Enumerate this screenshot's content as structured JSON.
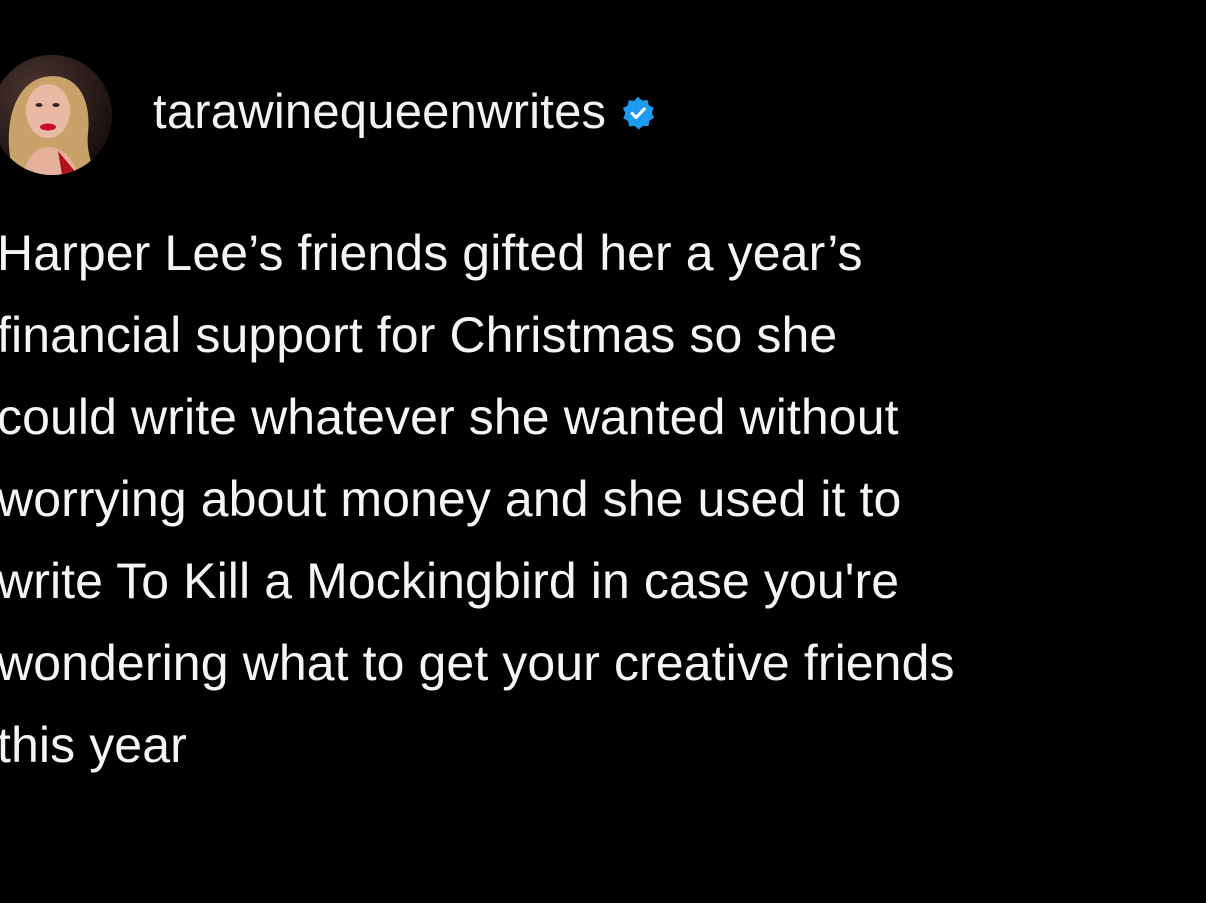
{
  "post": {
    "username": "tarawinequeenwrites",
    "verified_icon": "verified-badge-icon",
    "avatar": "profile-photo",
    "caption_lines": [
      "Harper Lee’s friends gifted her a year’s",
      "financial support for Christmas so she",
      "could write whatever she wanted without",
      "worrying about money and she used it to",
      "write To Kill a Mockingbird in case you're",
      "wondering what to get your creative friends",
      "this year"
    ]
  },
  "colors": {
    "background": "#000000",
    "text": "#f5f5f5",
    "verified_blue": "#1d9bf0"
  }
}
